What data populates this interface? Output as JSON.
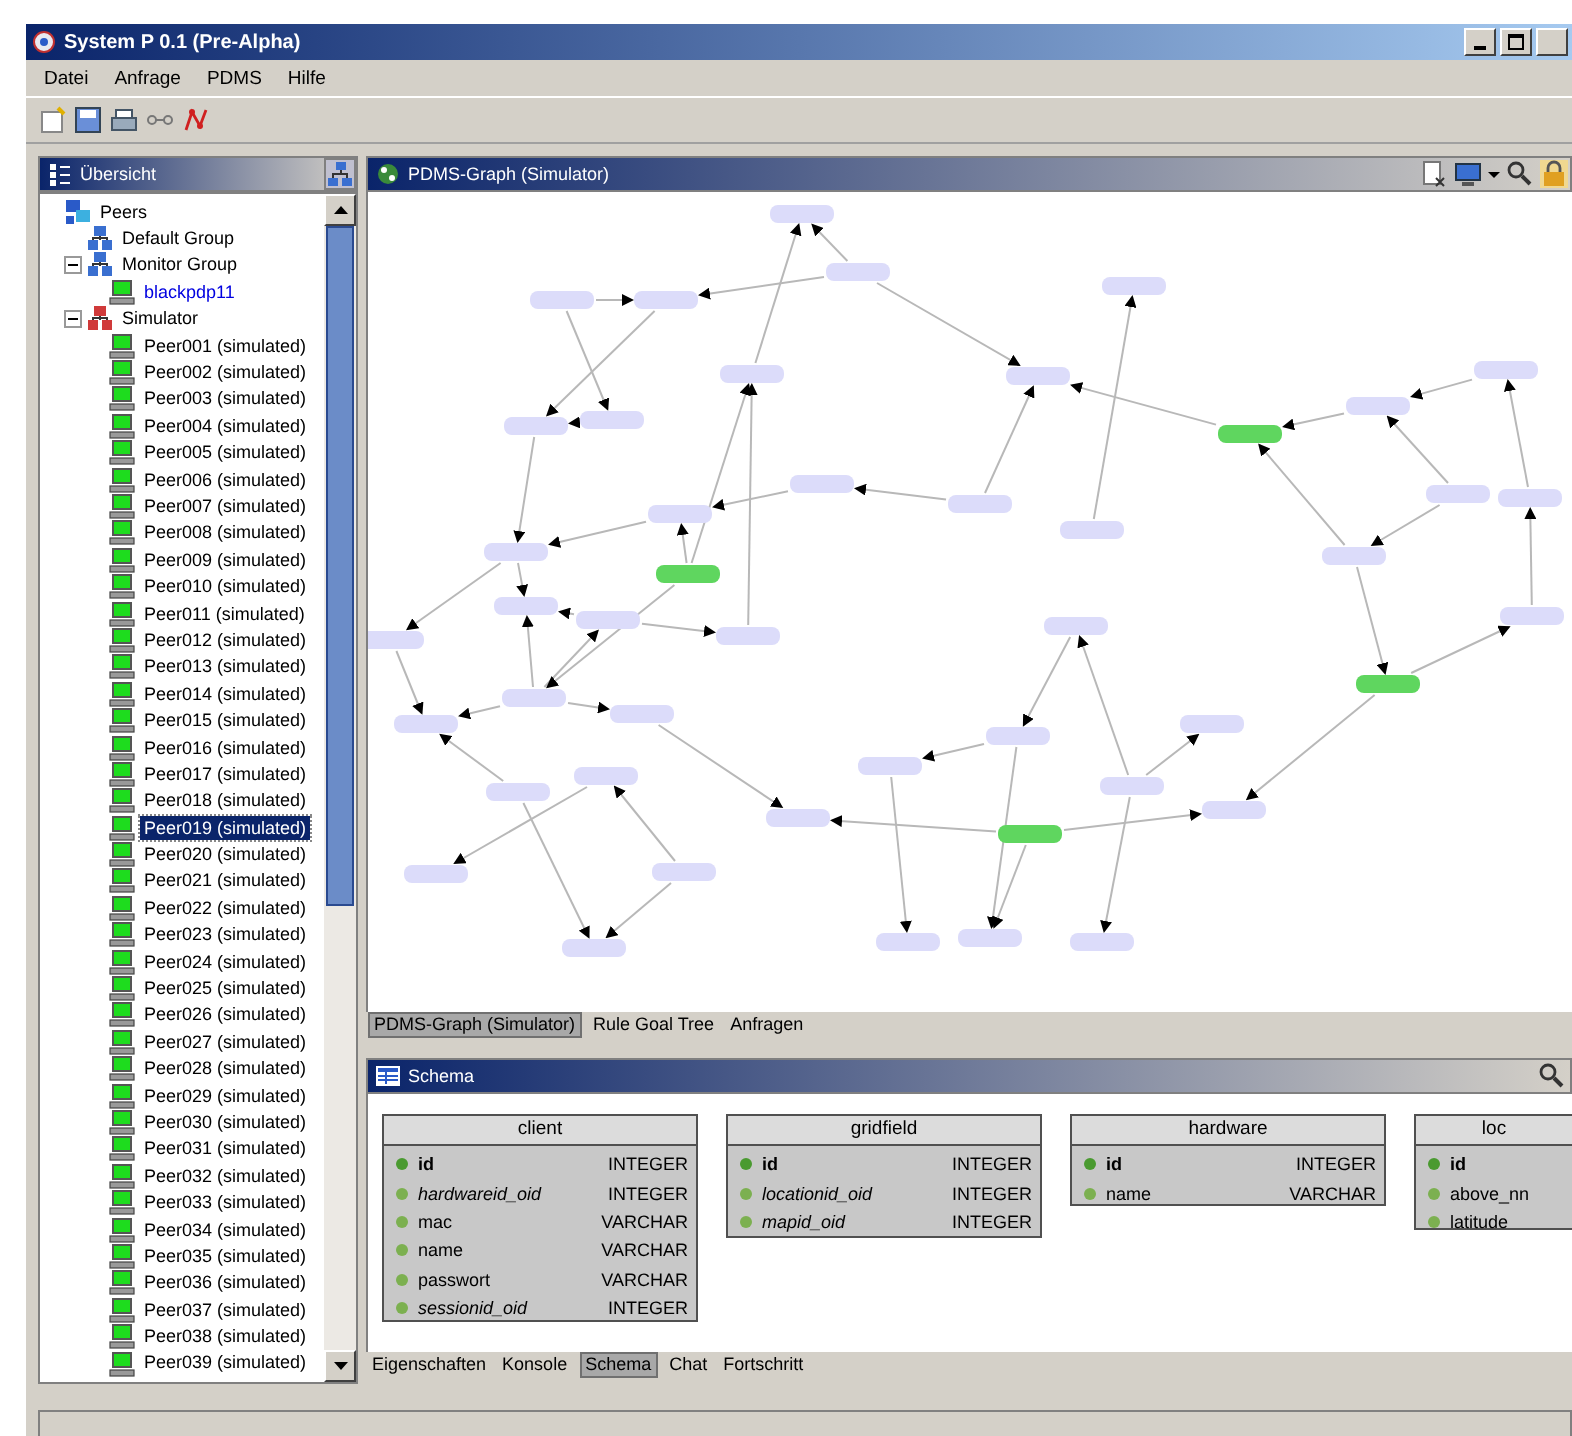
{
  "window": {
    "title": "System P 0.1 (Pre-Alpha)"
  },
  "menu": [
    {
      "label": "Datei"
    },
    {
      "label": "Anfrage"
    },
    {
      "label": "PDMS"
    },
    {
      "label": "Hilfe"
    }
  ],
  "overview": {
    "title": "Übersicht",
    "tree": [
      {
        "label": "Peers",
        "kind": "root",
        "selected": false,
        "children": [
          {
            "label": "Default Group",
            "kind": "group",
            "selected": false
          },
          {
            "label": "Monitor Group",
            "kind": "group",
            "expanded": true,
            "selected": false,
            "children": [
              {
                "label": "blackpdp11",
                "kind": "live-peer",
                "selected": false
              }
            ]
          },
          {
            "label": "Simulator",
            "kind": "sim-group",
            "expanded": true,
            "selected": false,
            "children": [
              {
                "label": "Peer001 (simulated)",
                "kind": "peer",
                "selected": false
              },
              {
                "label": "Peer002 (simulated)",
                "kind": "peer",
                "selected": false
              },
              {
                "label": "Peer003 (simulated)",
                "kind": "peer",
                "selected": false
              },
              {
                "label": "Peer004 (simulated)",
                "kind": "peer",
                "selected": false
              },
              {
                "label": "Peer005 (simulated)",
                "kind": "peer",
                "selected": false
              },
              {
                "label": "Peer006 (simulated)",
                "kind": "peer",
                "selected": false
              },
              {
                "label": "Peer007 (simulated)",
                "kind": "peer",
                "selected": false
              },
              {
                "label": "Peer008 (simulated)",
                "kind": "peer",
                "selected": false
              },
              {
                "label": "Peer009 (simulated)",
                "kind": "peer",
                "selected": false
              },
              {
                "label": "Peer010 (simulated)",
                "kind": "peer",
                "selected": false
              },
              {
                "label": "Peer011 (simulated)",
                "kind": "peer",
                "selected": false
              },
              {
                "label": "Peer012 (simulated)",
                "kind": "peer",
                "selected": false
              },
              {
                "label": "Peer013 (simulated)",
                "kind": "peer",
                "selected": false
              },
              {
                "label": "Peer014 (simulated)",
                "kind": "peer",
                "selected": false
              },
              {
                "label": "Peer015 (simulated)",
                "kind": "peer",
                "selected": false
              },
              {
                "label": "Peer016 (simulated)",
                "kind": "peer",
                "selected": false
              },
              {
                "label": "Peer017 (simulated)",
                "kind": "peer",
                "selected": false
              },
              {
                "label": "Peer018 (simulated)",
                "kind": "peer",
                "selected": false
              },
              {
                "label": "Peer019 (simulated)",
                "kind": "peer",
                "selected": true
              },
              {
                "label": "Peer020 (simulated)",
                "kind": "peer",
                "selected": false
              },
              {
                "label": "Peer021 (simulated)",
                "kind": "peer",
                "selected": false
              },
              {
                "label": "Peer022 (simulated)",
                "kind": "peer",
                "selected": false
              },
              {
                "label": "Peer023 (simulated)",
                "kind": "peer",
                "selected": false
              },
              {
                "label": "Peer024 (simulated)",
                "kind": "peer",
                "selected": false
              },
              {
                "label": "Peer025 (simulated)",
                "kind": "peer",
                "selected": false
              },
              {
                "label": "Peer026 (simulated)",
                "kind": "peer",
                "selected": false
              },
              {
                "label": "Peer027 (simulated)",
                "kind": "peer",
                "selected": false
              },
              {
                "label": "Peer028 (simulated)",
                "kind": "peer",
                "selected": false
              },
              {
                "label": "Peer029 (simulated)",
                "kind": "peer",
                "selected": false
              },
              {
                "label": "Peer030 (simulated)",
                "kind": "peer",
                "selected": false
              },
              {
                "label": "Peer031 (simulated)",
                "kind": "peer",
                "selected": false
              },
              {
                "label": "Peer032 (simulated)",
                "kind": "peer",
                "selected": false
              },
              {
                "label": "Peer033 (simulated)",
                "kind": "peer",
                "selected": false
              },
              {
                "label": "Peer034 (simulated)",
                "kind": "peer",
                "selected": false
              },
              {
                "label": "Peer035 (simulated)",
                "kind": "peer",
                "selected": false
              },
              {
                "label": "Peer036 (simulated)",
                "kind": "peer",
                "selected": false
              },
              {
                "label": "Peer037 (simulated)",
                "kind": "peer",
                "selected": false
              },
              {
                "label": "Peer038 (simulated)",
                "kind": "peer",
                "selected": false
              },
              {
                "label": "Peer039 (simulated)",
                "kind": "peer",
                "selected": false
              }
            ]
          }
        ]
      }
    ]
  },
  "graph_panel": {
    "title": "PDMS-Graph (Simulator)",
    "nodes": [
      {
        "active": false
      },
      {
        "active": false
      },
      {
        "active": false
      },
      {
        "active": false
      },
      {
        "active": false
      },
      {
        "active": false
      },
      {
        "active": false
      },
      {
        "active": false
      },
      {
        "active": false
      },
      {
        "active": false
      },
      {
        "active": true
      },
      {
        "active": false
      },
      {
        "active": false
      },
      {
        "active": false
      },
      {
        "active": false
      },
      {
        "active": false
      },
      {
        "active": false
      },
      {
        "active": false
      },
      {
        "active": false
      },
      {
        "active": false
      },
      {
        "active": false
      },
      {
        "active": false
      },
      {
        "active": false
      },
      {
        "active": false
      },
      {
        "active": false
      },
      {
        "active": false
      },
      {
        "active": false
      },
      {
        "active": false
      },
      {
        "active": true
      },
      {
        "active": false
      },
      {
        "active": false
      },
      {
        "active": false
      },
      {
        "active": false
      },
      {
        "active": false
      },
      {
        "active": false
      },
      {
        "active": false
      },
      {
        "active": false
      },
      {
        "active": false
      },
      {
        "active": true
      },
      {
        "active": false
      },
      {
        "active": false
      },
      {
        "active": false
      },
      {
        "active": false
      },
      {
        "active": false
      },
      {
        "active": false
      },
      {
        "active": true
      }
    ],
    "tabs": [
      {
        "label": "PDMS-Graph (Simulator)",
        "selected": true
      },
      {
        "label": "Rule Goal Tree",
        "selected": false
      },
      {
        "label": "Anfragen",
        "selected": false
      }
    ]
  },
  "schema_panel": {
    "title": "Schema",
    "tables": [
      {
        "name": "client",
        "columns": [
          {
            "name": "id",
            "type": "INTEGER",
            "kind": "key"
          },
          {
            "name": "hardwareid_oid",
            "type": "INTEGER",
            "kind": "foreign"
          },
          {
            "name": "mac",
            "type": "VARCHAR",
            "kind": "plain"
          },
          {
            "name": "name",
            "type": "VARCHAR",
            "kind": "plain"
          },
          {
            "name": "passwort",
            "type": "VARCHAR",
            "kind": "plain"
          },
          {
            "name": "sessionid_oid",
            "type": "INTEGER",
            "kind": "foreign"
          }
        ]
      },
      {
        "name": "gridfield",
        "columns": [
          {
            "name": "id",
            "type": "INTEGER",
            "kind": "key"
          },
          {
            "name": "locationid_oid",
            "type": "INTEGER",
            "kind": "foreign"
          },
          {
            "name": "mapid_oid",
            "type": "INTEGER",
            "kind": "foreign"
          }
        ]
      },
      {
        "name": "hardware",
        "columns": [
          {
            "name": "id",
            "type": "INTEGER",
            "kind": "key"
          },
          {
            "name": "name",
            "type": "VARCHAR",
            "kind": "plain"
          }
        ]
      },
      {
        "name": "loc",
        "columns": [
          {
            "name": "id",
            "kind": "key"
          },
          {
            "name": "above_nn",
            "kind": "plain"
          },
          {
            "name": "latitude",
            "kind": "plain"
          }
        ]
      }
    ],
    "tabs": [
      {
        "label": "Eigenschaften",
        "selected": false
      },
      {
        "label": "Konsole",
        "selected": false
      },
      {
        "label": "Schema",
        "selected": true
      },
      {
        "label": "Chat",
        "selected": false
      },
      {
        "label": "Fortschritt",
        "selected": false
      }
    ]
  }
}
